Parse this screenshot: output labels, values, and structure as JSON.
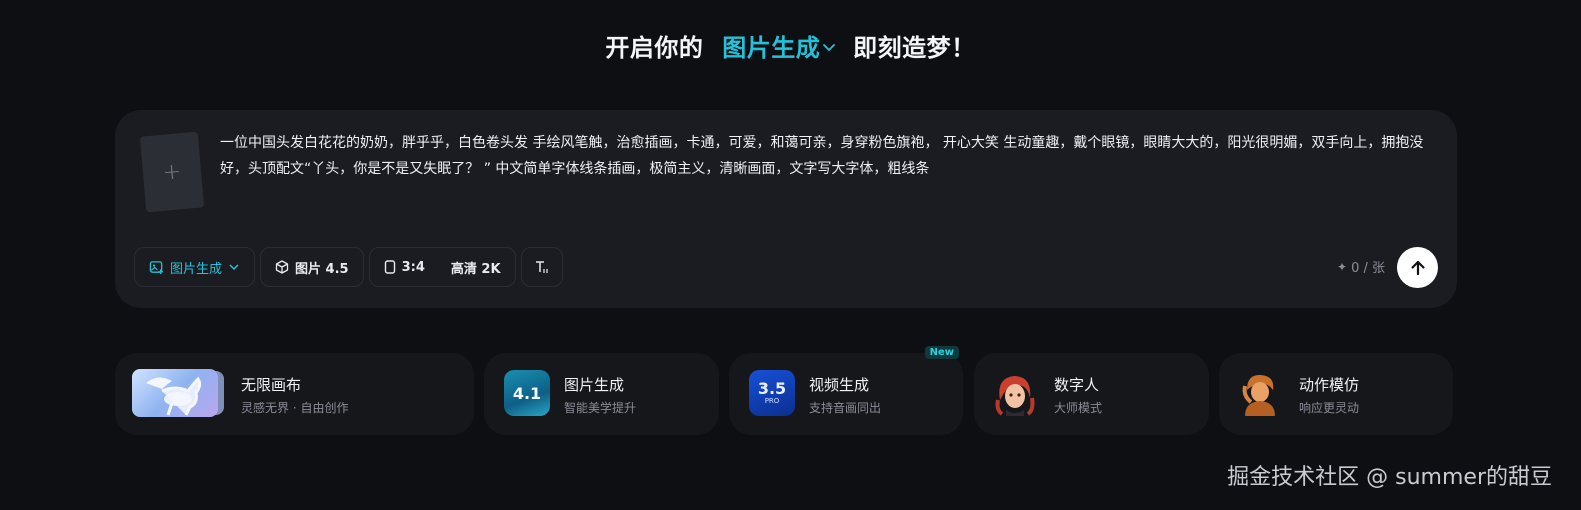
{
  "headline": {
    "prefix": "开启你的",
    "mode": "图片生成",
    "suffix": "即刻造梦！"
  },
  "prompt": {
    "text": "一位中国头发白花花的奶奶，胖乎乎，白色卷头发 手绘风笔触，治愈插画，卡通，可爱，和蔼可亲，身穿粉色旗袍， 开心大笑 生动童趣，戴个眼镜，眼睛大大的，阳光很明媚，双手向上，拥抱没好，头顶配文“丫头，你是不是又失眠了？ ” 中文简单字体线条插画，极简主义，清晰画面，文字写大字体，粗线条",
    "upload_icon": "plus-icon"
  },
  "toolbar": {
    "mode_label": "图片生成",
    "model_label": "图片 4.5",
    "ratio_label": "3:4",
    "quality_label": "高清 2K",
    "credits_label": "0 / 张"
  },
  "cards": [
    {
      "title": "无限画布",
      "subtitle": "灵感无界 · 自由创作"
    },
    {
      "title": "图片生成",
      "subtitle": "智能美学提升",
      "thumb_text": "4.1"
    },
    {
      "title": "视频生成",
      "subtitle": "支持音画同出",
      "thumb_text": "3.5",
      "thumb_sub": "PRO",
      "badge": "New"
    },
    {
      "title": "数字人",
      "subtitle": "大师模式"
    },
    {
      "title": "动作模仿",
      "subtitle": "响应更灵动"
    }
  ],
  "watermark": "掘金技术社区 @ summer的甜豆",
  "colors": {
    "background": "#0e0f12",
    "panel": "#1b1c21",
    "accent": "#23c2d9",
    "card": "#16171b"
  }
}
